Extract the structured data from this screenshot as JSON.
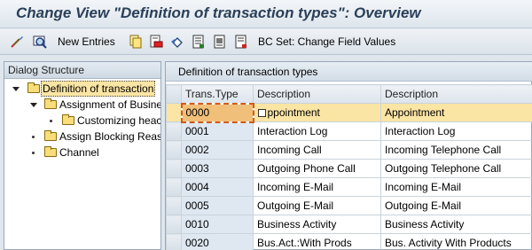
{
  "window": {
    "title": "Change View \"Definition of transaction types\": Overview"
  },
  "toolbar": {
    "new_entries_label": "New Entries",
    "bc_set_label": "BC Set: Change Field Values",
    "icons": [
      "glasses-icon",
      "display-icon",
      "copy-icon",
      "delete-icon",
      "undo-icon",
      "select-all-icon",
      "select-block-icon",
      "deselect-icon"
    ]
  },
  "dialog_structure": {
    "header": "Dialog Structure",
    "items": [
      {
        "label": "Definition of transaction",
        "level": 0,
        "expanded": true,
        "selected": true
      },
      {
        "label": "Assignment of Busine",
        "level": 1,
        "expanded": true,
        "selected": false
      },
      {
        "label": "Customizing heac",
        "level": 2,
        "expanded": false,
        "selected": false
      },
      {
        "label": "Assign Blocking Reaso",
        "level": 1,
        "expanded": false,
        "selected": false
      },
      {
        "label": "Channel",
        "level": 1,
        "expanded": false,
        "selected": false
      }
    ]
  },
  "table": {
    "title": "Definition of transaction types",
    "columns": [
      "Trans.Type",
      "Description",
      "Description"
    ],
    "rows": [
      {
        "type": "0000",
        "desc1": "ppointment",
        "desc2": "Appointment",
        "highlight": true
      },
      {
        "type": "0001",
        "desc1": "Interaction Log",
        "desc2": "Interaction Log",
        "highlight": false
      },
      {
        "type": "0002",
        "desc1": "Incoming Call",
        "desc2": "Incoming Telephone Call",
        "highlight": false
      },
      {
        "type": "0003",
        "desc1": "Outgoing Phone Call",
        "desc2": "Outgoing Telephone Call",
        "highlight": false
      },
      {
        "type": "0004",
        "desc1": "Incoming E-Mail",
        "desc2": "Incoming E-Mail",
        "highlight": false
      },
      {
        "type": "0005",
        "desc1": "Outgoing E-Mail",
        "desc2": "Outgoing E-Mail",
        "highlight": false
      },
      {
        "type": "0010",
        "desc1": "Business Activity",
        "desc2": "Business Activity",
        "highlight": false
      },
      {
        "type": "0020",
        "desc1": "Bus.Act.:With Prods",
        "desc2": "Bus. Activity With Products",
        "highlight": false
      }
    ]
  },
  "colors": {
    "title_text": "#2a3f58",
    "highlight_row": "#fbe5a4",
    "highlight_key": "#f0c07a",
    "focus_border": "#d05a1e"
  }
}
